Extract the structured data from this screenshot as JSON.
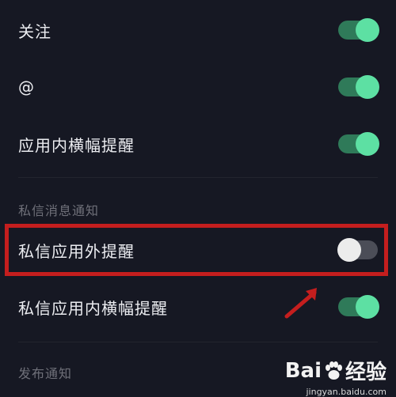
{
  "settings": {
    "rows": [
      {
        "label": "关注",
        "state": "on"
      },
      {
        "label": "@",
        "state": "on"
      },
      {
        "label": "应用内横幅提醒",
        "state": "on"
      }
    ],
    "private_section": {
      "title": "私信消息通知",
      "rows": [
        {
          "label": "私信应用外提醒",
          "state": "off"
        },
        {
          "label": "私信应用内横幅提醒",
          "state": "on"
        }
      ]
    },
    "publish_section": {
      "title": "发布通知"
    }
  },
  "colors": {
    "background": "#161823",
    "toggle_on_track": "#2f7a59",
    "toggle_on_knob": "#5de0a3",
    "toggle_off_track": "#4b4d57",
    "toggle_off_knob": "#ececec",
    "highlight": "#c41e1e"
  },
  "watermark": {
    "logo_left": "Bai",
    "logo_right": "经验",
    "url": "jingyan.baidu.com"
  },
  "icons": [
    "red-arrow-annotation-icon",
    "baidu-paw-icon"
  ]
}
